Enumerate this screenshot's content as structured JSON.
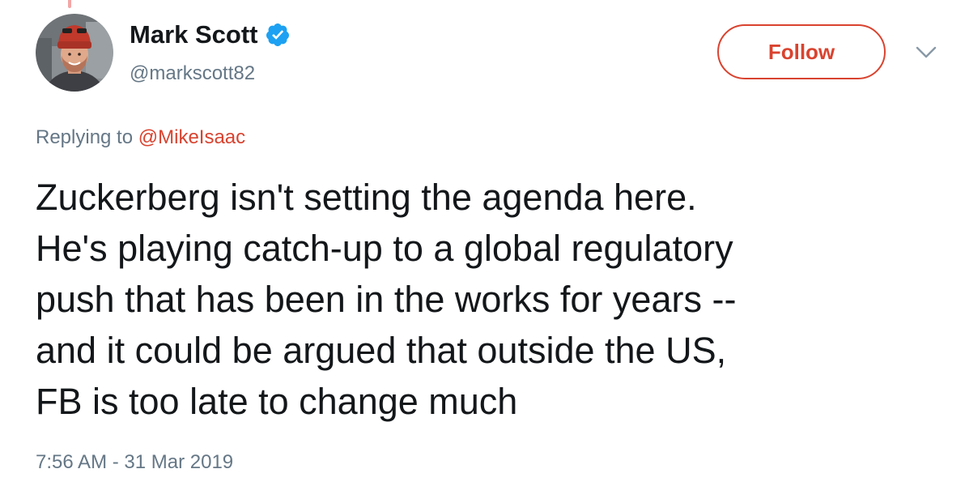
{
  "author": {
    "display_name": "Mark Scott",
    "handle": "@markscott82",
    "verified": true,
    "avatar_icon": "profile-photo"
  },
  "actions": {
    "follow_label": "Follow",
    "more_icon": "chevron-down-icon"
  },
  "reply": {
    "prefix": "Replying to ",
    "mention": "@MikeIsaac"
  },
  "tweet": {
    "text_lines": [
      "Zuckerberg isn't setting the agenda here.",
      "He's playing catch-up to a global regulatory",
      "push that has been in the works for years --",
      "and it could be argued that outside the US,",
      "FB is too late to change much"
    ],
    "timestamp": "7:56 AM - 31 Mar 2019"
  },
  "colors": {
    "accent": "#d9432f",
    "verified": "#1da1f2",
    "text": "#14171a",
    "muted": "#657786"
  }
}
